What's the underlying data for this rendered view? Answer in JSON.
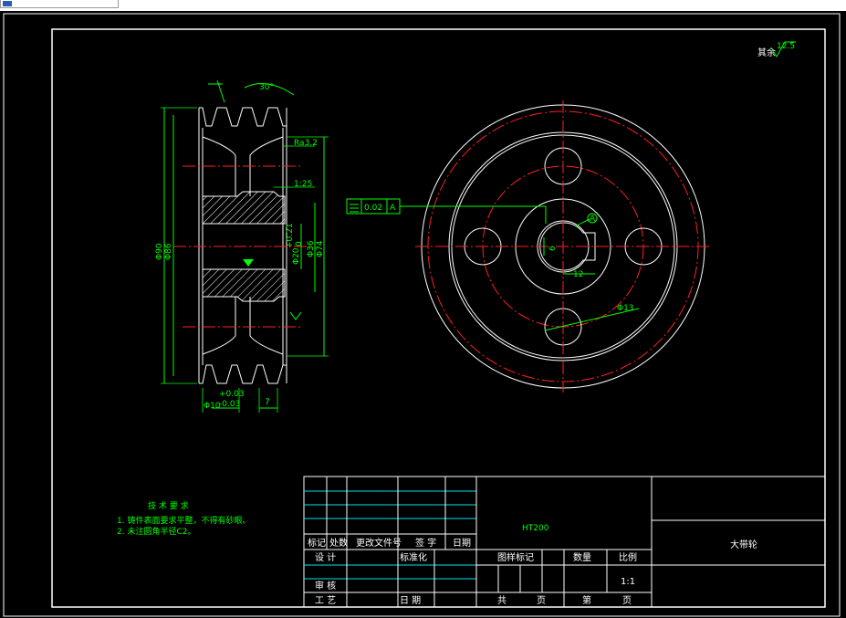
{
  "drawing": {
    "part_name": "大带轮",
    "material": "HT200",
    "roughness_note": "其余",
    "roughness_value": "12.5"
  },
  "tech_requirements": {
    "title": "技 术 要 求",
    "items": [
      "1. 铸件表面要求平整，不得有砂眼。",
      "2. 未注圆角半径C2。"
    ]
  },
  "title_block": {
    "revision_headers": [
      "标记",
      "处数",
      "更改文件号",
      "签 字",
      "日期"
    ],
    "row_labels": [
      "设 计",
      "标准化",
      "审 核",
      "工 艺",
      "日 期"
    ],
    "info_headers": [
      "图样标记",
      "数量",
      "比例"
    ],
    "scale": "1:1",
    "sheet_total_label": "共",
    "sheet_total_unit": "页",
    "sheet_current_label": "第",
    "sheet_current_unit": "页"
  },
  "dimensions": {
    "groove_angle": "30°",
    "d_outer": "Φ90",
    "d_86": "Φ86",
    "d_74": "Φ74",
    "d_36": "Φ36",
    "d_bore": "Φ20",
    "bore_tol_upper": "+0.21",
    "bore_tol_lower": "0",
    "hub_width": "Φ10",
    "hub_tol_upper": "+0.03",
    "hub_tol_lower": "-0.03",
    "groove_pitch": "7",
    "keyway_width": "6",
    "keyway_depth": "12",
    "hole_dia": "Φ13",
    "circ_runout": "0.02",
    "datum": "A",
    "small_label_1": "Ra3.2",
    "small_label_2": "1:25",
    "callout_a": "A"
  }
}
